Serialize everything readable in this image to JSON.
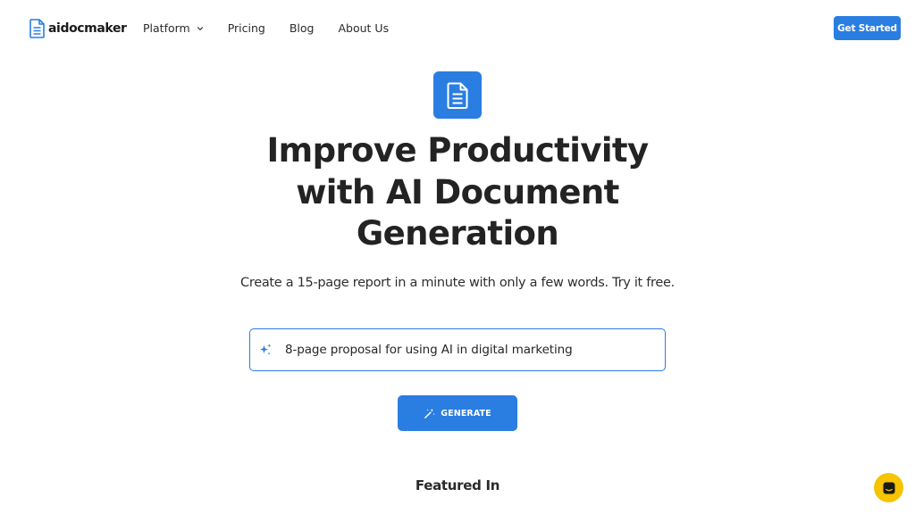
{
  "header": {
    "logo_text": "aidocmaker",
    "nav": [
      {
        "label": "Platform",
        "has_dropdown": true
      },
      {
        "label": "Pricing"
      },
      {
        "label": "Blog"
      },
      {
        "label": "About Us"
      }
    ],
    "cta_label": "Get Started"
  },
  "hero": {
    "icon": "document-icon",
    "title_lines": [
      "Improve Productivity",
      "with AI Document",
      "Generation"
    ],
    "subtitle": "Create a 15-page report in a minute with only a few words. Try it free."
  },
  "prompt": {
    "icon": "sparkle-icon",
    "value": "8-page proposal for using AI in digital marketing"
  },
  "generate_button": {
    "icon": "magic-wand-icon",
    "label": "GENERATE"
  },
  "featured_heading": "Featured In",
  "chat_widget": {
    "icon": "chat-icon"
  },
  "colors": {
    "accent": "#2a7de1",
    "chat": "#f6c400",
    "text": "#232323"
  }
}
